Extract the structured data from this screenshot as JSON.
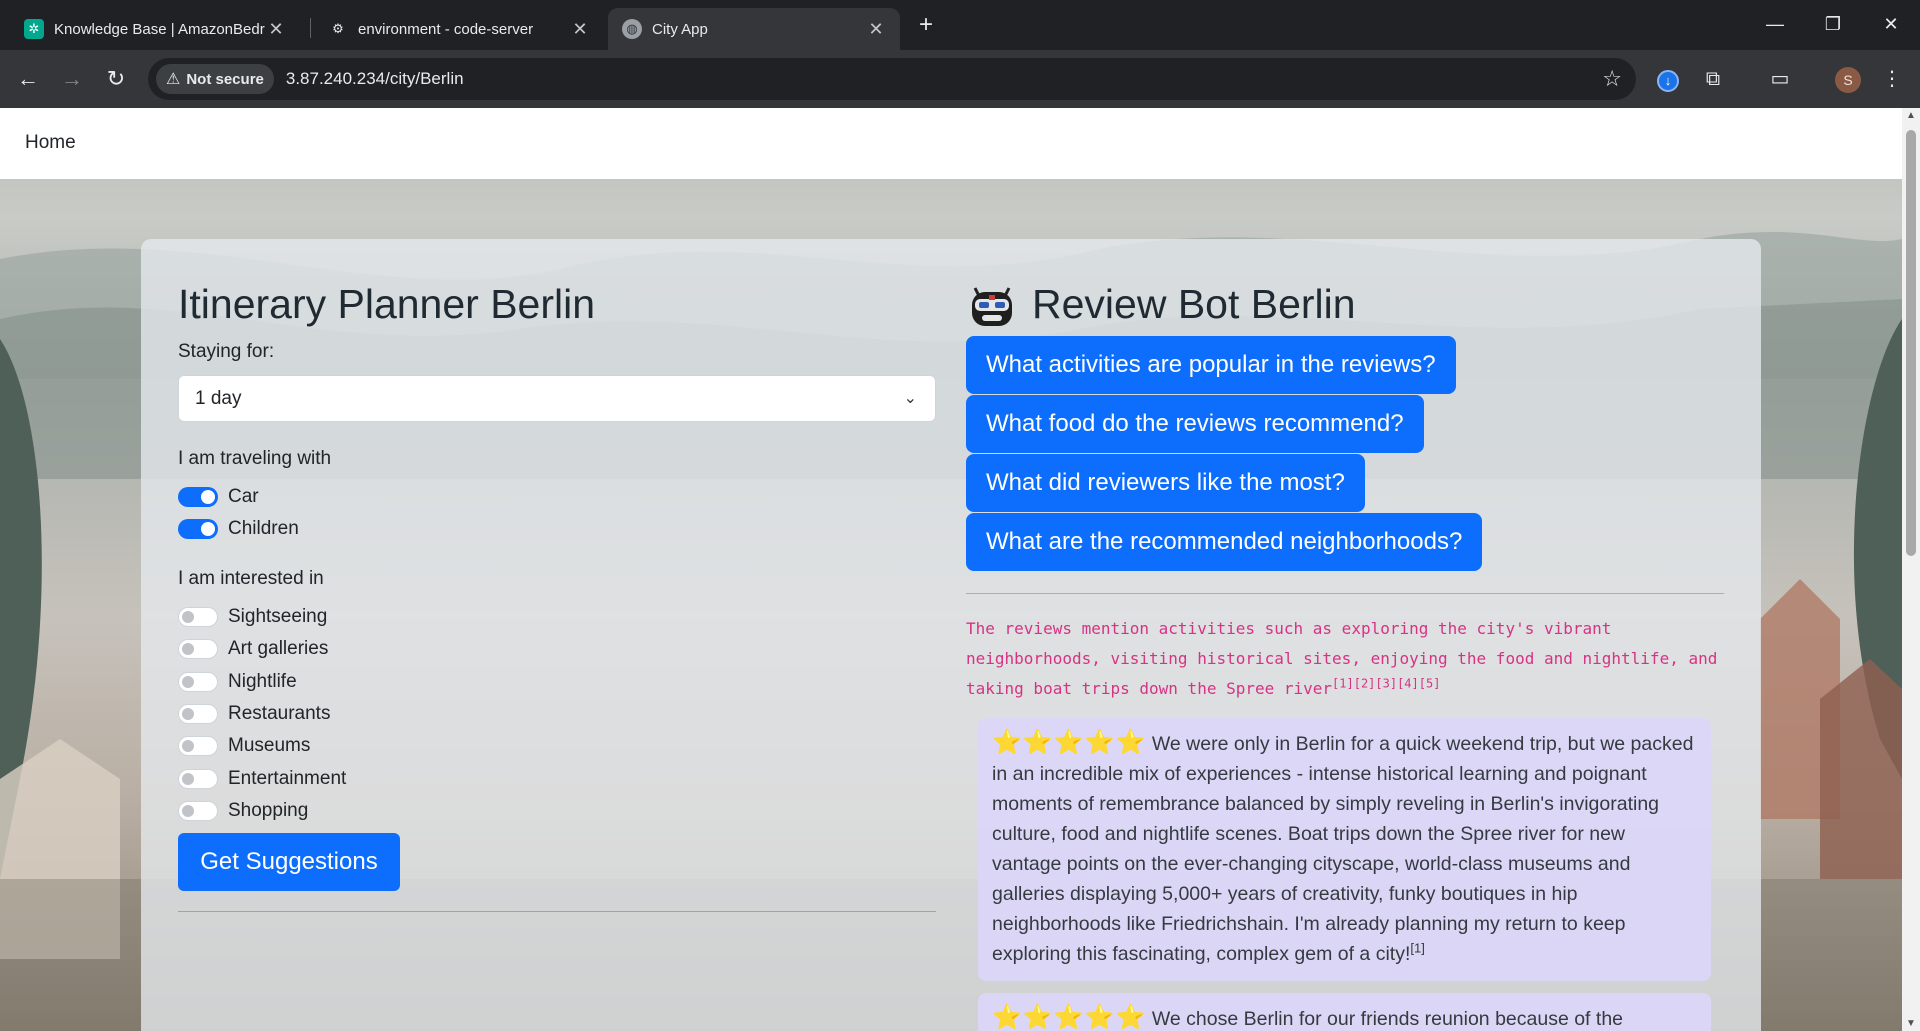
{
  "browser": {
    "tabs": [
      {
        "title": "Knowledge Base | AmazonBedr",
        "icon": "bedrock-icon"
      },
      {
        "title": "environment - code-server",
        "icon": "code-server-icon"
      },
      {
        "title": "City App",
        "icon": "globe-icon"
      }
    ],
    "security_chip": "Not secure",
    "url": "3.87.240.234/city/Berlin",
    "profile_initial": "S"
  },
  "nav": {
    "home": "Home"
  },
  "planner": {
    "title": "Itinerary Planner Berlin",
    "stay_label": "Staying for:",
    "stay_value": "1 day",
    "traveling_label": "I am traveling with",
    "traveling": [
      {
        "label": "Car",
        "on": true
      },
      {
        "label": "Children",
        "on": true
      }
    ],
    "interest_label": "I am interested in",
    "interests": [
      {
        "label": "Sightseeing",
        "on": false
      },
      {
        "label": "Art galleries",
        "on": false
      },
      {
        "label": "Nightlife",
        "on": false
      },
      {
        "label": "Restaurants",
        "on": false
      },
      {
        "label": "Museums",
        "on": false
      },
      {
        "label": "Entertainment",
        "on": false
      },
      {
        "label": "Shopping",
        "on": false
      }
    ],
    "submit": "Get Suggestions"
  },
  "reviewbot": {
    "title": "Review Bot Berlin",
    "questions": [
      "What activities are popular in the reviews?",
      "What food do the reviews recommend?",
      "What did reviewers like the most?",
      "What are the recommended neighborhoods?"
    ],
    "answer": "The reviews mention activities such as exploring the city's vibrant neighborhoods, visiting historical sites, enjoying the food and nightlife, and taking boat trips down the Spree river",
    "answer_refs": "[1][2][3][4][5]",
    "reviews": [
      {
        "stars": "⭐⭐⭐⭐⭐",
        "text": "We were only in Berlin for a quick weekend trip, but we packed in an incredible mix of experiences - intense historical learning and poignant moments of remembrance balanced by simply reveling in Berlin's invigorating culture, food and nightlife scenes. Boat trips down the Spree river for new vantage points on the ever-changing cityscape, world-class museums and galleries displaying 5,000+ years of creativity, funky boutiques in hip neighborhoods like Friedrichshain. I'm already planning my return to keep exploring this fascinating, complex gem of a city!",
        "ref": "[1]"
      },
      {
        "stars": "⭐⭐⭐⭐⭐",
        "text": "We chose Berlin for our friends reunion because of the",
        "ref": ""
      }
    ]
  },
  "colors": {
    "primary": "#0d6efd",
    "answer_text": "#d63384",
    "review_bg": "#dcd6f8"
  }
}
